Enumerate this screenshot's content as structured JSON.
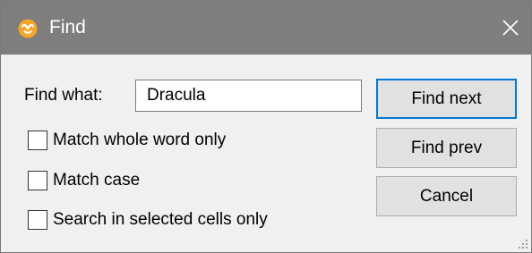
{
  "window": {
    "title": "Find",
    "icons": {
      "app": "altova-app-icon",
      "close": "close-icon",
      "grip": "resize-grip-icon"
    },
    "colors": {
      "titlebar": "#7e7e7e",
      "app_icon": "#f5a623",
      "default_button_border": "#0078d7"
    }
  },
  "form": {
    "find_what_label": "Find what:",
    "find_what_value": "Dracula",
    "options": [
      {
        "label": "Match whole word only",
        "checked": false
      },
      {
        "label": "Match case",
        "checked": false
      },
      {
        "label": "Search in selected cells only",
        "checked": false
      }
    ]
  },
  "buttons": {
    "find_next": "Find next",
    "find_prev": "Find prev",
    "cancel": "Cancel"
  }
}
